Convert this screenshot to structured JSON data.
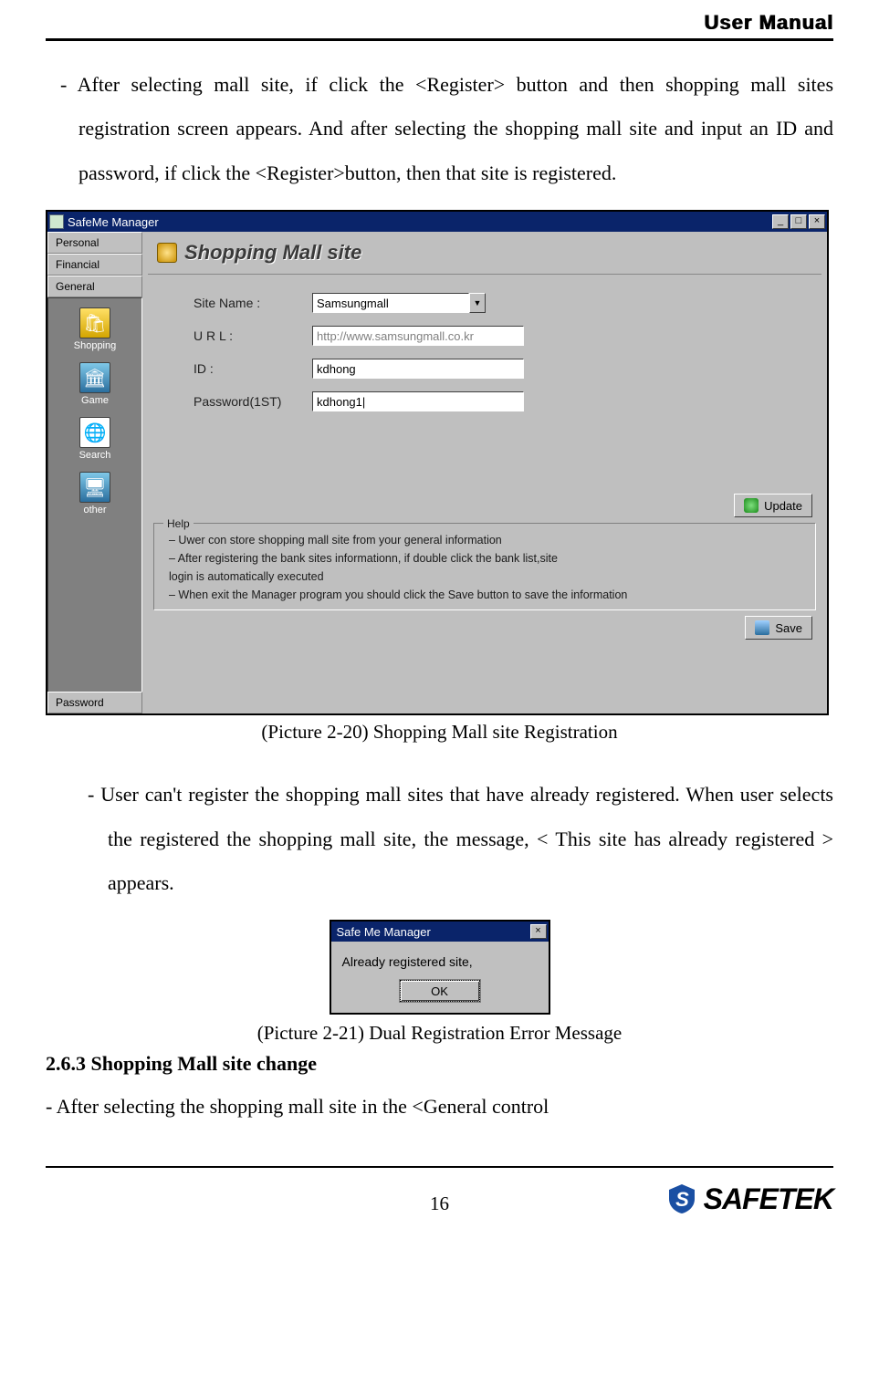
{
  "header": {
    "title": "User Manual"
  },
  "paragraphs": {
    "p1": "- After selecting mall site, if click the <Register> button and then shopping mall sites registration screen appears. And after selecting the shopping mall site and input an ID and password, if click the <Register>button, then that site is registered.",
    "caption1": "(Picture 2-20) Shopping Mall site Registration",
    "p2": "-   User can't register the shopping mall sites that have already registered. When user selects the registered the shopping mall site, the message, < This site has already registered > appears.",
    "caption2": "(Picture 2-21) Dual Registration Error Message",
    "section": "2.6.3 Shopping Mall site change",
    "p3": "- After selecting the shopping mall site in the <General control"
  },
  "win": {
    "title": "SafeMe Manager",
    "min": "_",
    "max": "□",
    "close": "×",
    "sidebar": {
      "tabs": [
        "Personal",
        "Financial",
        "General"
      ],
      "items": [
        "Shopping",
        "Game",
        "Search",
        "other"
      ],
      "bottom": "Password"
    },
    "panel_title": "Shopping Mall site",
    "form": {
      "site_label": "Site Name  :",
      "site_value": "Samsungmall",
      "url_label": "U R L :",
      "url_value": "http://www.samsungmall.co.kr",
      "id_label": "ID  :",
      "id_value": "kdhong",
      "pw_label": "Password(1ST)",
      "pw_value": "kdhong1|"
    },
    "update_btn": "Update",
    "help": {
      "legend": "Help",
      "l1": "– Uwer con store shopping mall site from your general information",
      "l2": "– After registering the bank sites informationn, if double click the bank list,site",
      "l3": "   login is automatically executed",
      "l4": "– When exit the Manager program you should click the Save button to save the information"
    },
    "save_btn": "Save"
  },
  "dlg": {
    "title": "Safe Me Manager",
    "close": "×",
    "msg": "Already registered site,",
    "ok": "OK"
  },
  "footer": {
    "page": "16",
    "brand": "SAFETEK"
  }
}
